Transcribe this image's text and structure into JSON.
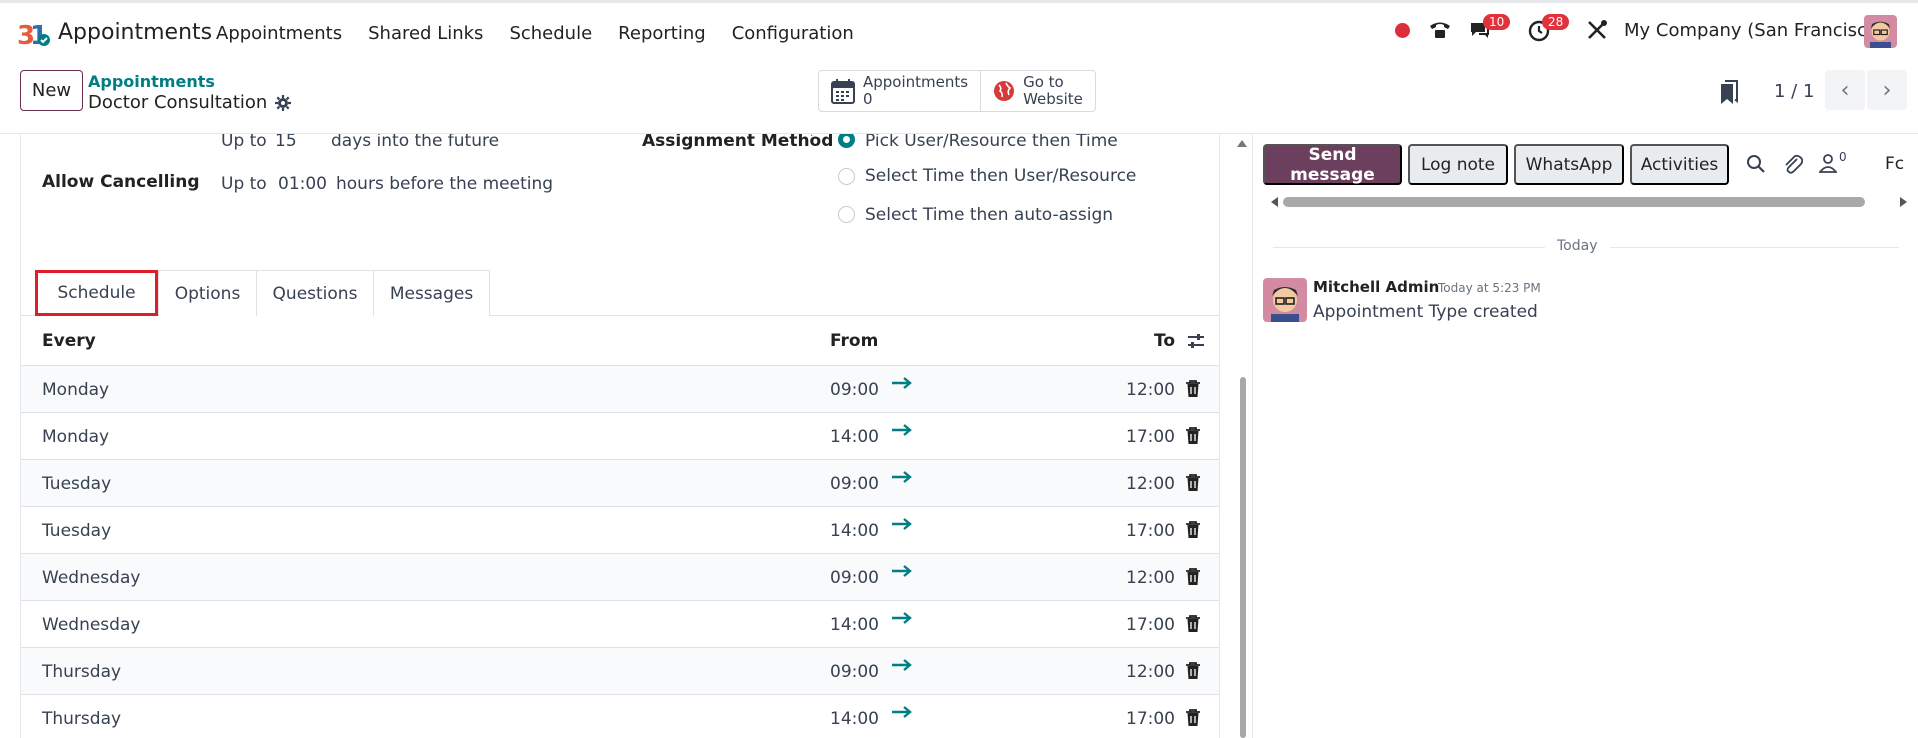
{
  "app": {
    "title": "Appointments"
  },
  "nav": [
    "Appointments",
    "Shared Links",
    "Schedule",
    "Reporting",
    "Configuration"
  ],
  "systray": {
    "messages_badge": "10",
    "activities_badge": "28",
    "company": "My Company (San Francisco)"
  },
  "control": {
    "new_label": "New",
    "breadcrumb_parent": "Appointments",
    "breadcrumb_current": "Doctor Consultation",
    "smart_buttons": [
      {
        "line1": "Appointments",
        "line2": "0"
      },
      {
        "line1": "Go to",
        "line2": "Website"
      }
    ],
    "pager": "1 / 1"
  },
  "form": {
    "upto_prefix": "Up to",
    "future_value": "15",
    "future_suffix": "days into the future",
    "allow_cancelling_label": "Allow Cancelling",
    "cancel_prefix": "Up to",
    "cancel_value": "01:00",
    "cancel_suffix": "hours before the meeting",
    "assignment_label": "Assignment Method",
    "assignment_options": [
      {
        "label": "Pick User/Resource then Time",
        "checked": true
      },
      {
        "label": "Select Time then User/Resource",
        "checked": false
      },
      {
        "label": "Select Time then auto-assign",
        "checked": false
      }
    ]
  },
  "tabs": [
    "Schedule",
    "Options",
    "Questions",
    "Messages"
  ],
  "schedule": {
    "headers": {
      "every": "Every",
      "from": "From",
      "to": "To"
    },
    "rows": [
      {
        "day": "Monday",
        "from": "09:00",
        "to": "12:00"
      },
      {
        "day": "Monday",
        "from": "14:00",
        "to": "17:00"
      },
      {
        "day": "Tuesday",
        "from": "09:00",
        "to": "12:00"
      },
      {
        "day": "Tuesday",
        "from": "14:00",
        "to": "17:00"
      },
      {
        "day": "Wednesday",
        "from": "09:00",
        "to": "12:00"
      },
      {
        "day": "Wednesday",
        "from": "14:00",
        "to": "17:00"
      },
      {
        "day": "Thursday",
        "from": "09:00",
        "to": "12:00"
      },
      {
        "day": "Thursday",
        "from": "14:00",
        "to": "17:00"
      }
    ]
  },
  "chatter": {
    "send_message": "Send message",
    "log_note": "Log note",
    "whatsapp": "WhatsApp",
    "activities": "Activities",
    "followers_count": "0",
    "follow_label": "Fc",
    "today": "Today",
    "message": {
      "author": "Mitchell Admin",
      "time": "Today at 5:23 PM",
      "body": "Appointment Type created"
    }
  },
  "colors": {
    "brand": "#6b3f5d",
    "teal": "#017e84",
    "highlight": "#e11d2a",
    "badge": "#e0313d"
  }
}
